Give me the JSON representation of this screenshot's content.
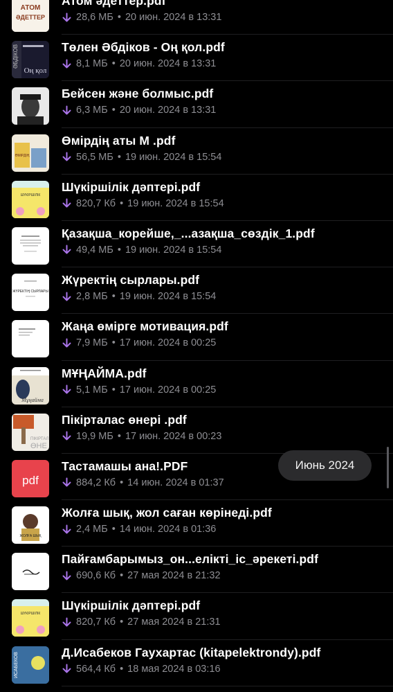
{
  "accent": "#a974e8",
  "date_pill": "Июнь 2024",
  "files": [
    {
      "title": "Атом әдеттер.pdf",
      "size": "28,6 МБ",
      "date": "20 июн. 2024 в 13:31",
      "icon": "book-cover-atomic-habits-icon",
      "thumb": "atom",
      "cover_text": "АТОМ ӘДЕТТЕР"
    },
    {
      "title": "Төлен Әбдіков - Оң қол.pdf",
      "size": "8,1 МБ",
      "date": "20 июн. 2024 в 13:31",
      "icon": "book-cover-on-qol-icon",
      "thumb": "onqol",
      "cover_text": "Оң қол"
    },
    {
      "title": "Бейсен және болмыс.pdf",
      "size": "6,3 МБ",
      "date": "20 июн. 2024 в 13:31",
      "icon": "book-cover-portrait-icon",
      "thumb": "portrait"
    },
    {
      "title": "Өмірдің аты М .pdf",
      "size": "56,5 МБ",
      "date": "19 июн. 2024 в 15:54",
      "icon": "book-cover-omirdin-aty-icon",
      "thumb": "omir"
    },
    {
      "title": "Шүкіршілік дәптері.pdf",
      "size": "820,7 Кб",
      "date": "19 июн. 2024 в 15:54",
      "icon": "book-cover-notebook-icon",
      "thumb": "shukir"
    },
    {
      "title": "Қазақша_корейше,_...азақша_сөздік_1.pdf",
      "size": "49,4 МБ",
      "date": "19 июн. 2024 в 15:54",
      "icon": "document-page-icon",
      "thumb": "doc"
    },
    {
      "title": "Жүректің сырлары.pdf",
      "size": "2,8 МБ",
      "date": "19 июн. 2024 в 15:54",
      "icon": "document-page-icon",
      "thumb": "doc2"
    },
    {
      "title": "Жаңа өмірге мотивация.pdf",
      "size": "7,9 МБ",
      "date": "17 июн. 2024 в 00:25",
      "icon": "document-page-icon",
      "thumb": "doc3"
    },
    {
      "title": "МҰҢАЙМА.pdf",
      "size": "5,1 МБ",
      "date": "17 июн. 2024 в 00:25",
      "icon": "book-cover-munaima-icon",
      "thumb": "munaima"
    },
    {
      "title": "Пікірталас өнері .pdf",
      "size": "19,9 МБ",
      "date": "17 июн. 2024 в 00:23",
      "icon": "book-cover-pikirtalas-icon",
      "thumb": "pikir"
    },
    {
      "title": "Тастамашы ана!.PDF",
      "size": "884,2 Кб",
      "date": "14 июн. 2024 в 01:37",
      "icon": "pdf-file-icon",
      "thumb": "pdf",
      "pdf_label": "pdf"
    },
    {
      "title": "Жолға шық, жол саған көрінеді.pdf",
      "size": "2,4 МБ",
      "date": "14 июн. 2024 в 01:36",
      "icon": "book-cover-person-icon",
      "thumb": "person"
    },
    {
      "title": "Пайғамбарымыз_он...елікті_іс_әрекеті.pdf",
      "size": "690,6 Кб",
      "date": "27 мая 2024 в 21:32",
      "icon": "document-calligraphy-icon",
      "thumb": "callig"
    },
    {
      "title": "Шүкіршілік дәптері.pdf",
      "size": "820,7 Кб",
      "date": "27 мая 2024 в 21:31",
      "icon": "book-cover-notebook-icon",
      "thumb": "shukir"
    },
    {
      "title": "Д.Исабеков Гаухартас (kitapelektrondy).pdf",
      "size": "564,4 Кб",
      "date": "18 мая 2024 в 03:16",
      "icon": "book-cover-gauhartas-icon",
      "thumb": "gauhar"
    }
  ]
}
